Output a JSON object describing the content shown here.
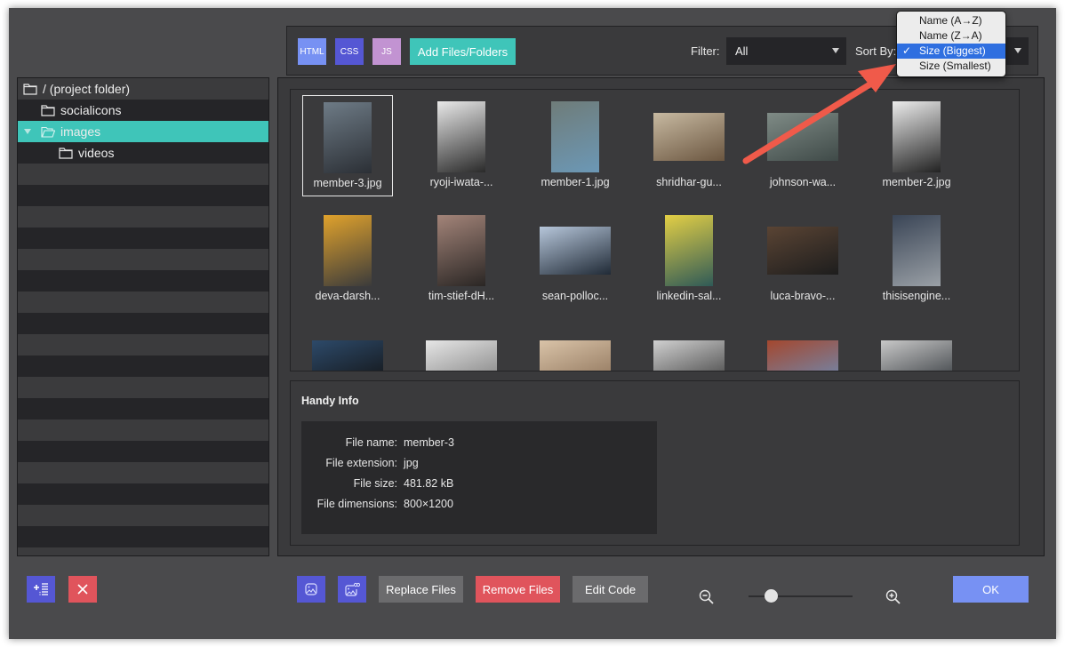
{
  "toolbar": {
    "html_label": "HTML",
    "css_label": "CSS",
    "js_label": "JS",
    "add_label": "Add Files/Folders",
    "filter_label": "Filter:",
    "filter_value": "All",
    "sort_label": "Sort By:",
    "sort_value": "Size (Biggest)"
  },
  "sort_menu": {
    "items": [
      {
        "label": "Name (A→Z)",
        "checked": false
      },
      {
        "label": "Name (Z→A)",
        "checked": false
      },
      {
        "label": "Size (Biggest)",
        "checked": true
      },
      {
        "label": "Size (Smallest)",
        "checked": false
      }
    ],
    "check_glyph": "✓"
  },
  "tree": {
    "items": [
      {
        "label": "/ (project folder)",
        "depth": 0,
        "icon": "folder-icon"
      },
      {
        "label": "socialicons",
        "depth": 1,
        "icon": "folder-icon"
      },
      {
        "label": "images",
        "depth": 1,
        "icon": "folder-open-icon",
        "selected": true,
        "expanded": true
      },
      {
        "label": "videos",
        "depth": 2,
        "icon": "folder-icon"
      }
    ]
  },
  "files": [
    {
      "name": "member-3.jpg",
      "orient": "portrait",
      "colors": [
        "#6e7b86",
        "#2b2f35"
      ],
      "selected": true
    },
    {
      "name": "ryoji-iwata-...",
      "orient": "portrait",
      "colors": [
        "#e9e9e9",
        "#2a2a2a"
      ]
    },
    {
      "name": "member-1.jpg",
      "orient": "portrait",
      "colors": [
        "#6f7c79",
        "#6c98b6"
      ]
    },
    {
      "name": "shridhar-gu...",
      "orient": "landscape",
      "colors": [
        "#c7b9a1",
        "#6b5640"
      ]
    },
    {
      "name": "johnson-wa...",
      "orient": "landscape",
      "colors": [
        "#7f8b86",
        "#3f4a48"
      ]
    },
    {
      "name": "member-2.jpg",
      "orient": "portrait",
      "colors": [
        "#ececec",
        "#222222"
      ]
    },
    {
      "name": "deva-darsh...",
      "orient": "portrait",
      "colors": [
        "#e0a22c",
        "#3b3b3b"
      ]
    },
    {
      "name": "tim-stief-dH...",
      "orient": "portrait",
      "colors": [
        "#a38479",
        "#2a2624"
      ]
    },
    {
      "name": "sean-polloc...",
      "orient": "landscape",
      "colors": [
        "#b6c6da",
        "#202a36"
      ]
    },
    {
      "name": "linkedin-sal...",
      "orient": "portrait",
      "colors": [
        "#e3cf45",
        "#2f5a57"
      ]
    },
    {
      "name": "luca-bravo-...",
      "orient": "landscape",
      "colors": [
        "#5a4434",
        "#1d1d1d"
      ]
    },
    {
      "name": "thisisengine...",
      "orient": "portrait",
      "colors": [
        "#3a4556",
        "#9aa0a6"
      ]
    },
    {
      "name": "",
      "orient": "landscape",
      "colors": [
        "#2d4a6a",
        "#121212"
      ]
    },
    {
      "name": "",
      "orient": "landscape",
      "colors": [
        "#e6e6e6",
        "#7b7b7b"
      ]
    },
    {
      "name": "",
      "orient": "landscape",
      "colors": [
        "#d9c3a8",
        "#8a6f56"
      ]
    },
    {
      "name": "",
      "orient": "landscape",
      "colors": [
        "#d0d0d0",
        "#3a3a3a"
      ]
    },
    {
      "name": "",
      "orient": "landscape",
      "colors": [
        "#a4472e",
        "#6a8fbb"
      ]
    },
    {
      "name": "",
      "orient": "landscape",
      "colors": [
        "#c8c8c8",
        "#2e3338"
      ]
    }
  ],
  "info": {
    "title": "Handy Info",
    "rows": [
      {
        "key": "File name:",
        "value": "member-3"
      },
      {
        "key": "File extension:",
        "value": "jpg"
      },
      {
        "key": "File size:",
        "value": "481.82 kB"
      },
      {
        "key": "File dimensions:",
        "value": "800×1200"
      }
    ]
  },
  "bottom": {
    "replace_label": "Replace Files",
    "remove_label": "Remove Files",
    "edit_label": "Edit Code",
    "ok_label": "OK",
    "zoom_level": 0.22
  },
  "colors": {
    "accent_teal": "#3fc5b9",
    "purple": "#5557d4",
    "blue": "#7791f3",
    "red": "#e0545c",
    "annotation_arrow": "#f05a4a"
  }
}
